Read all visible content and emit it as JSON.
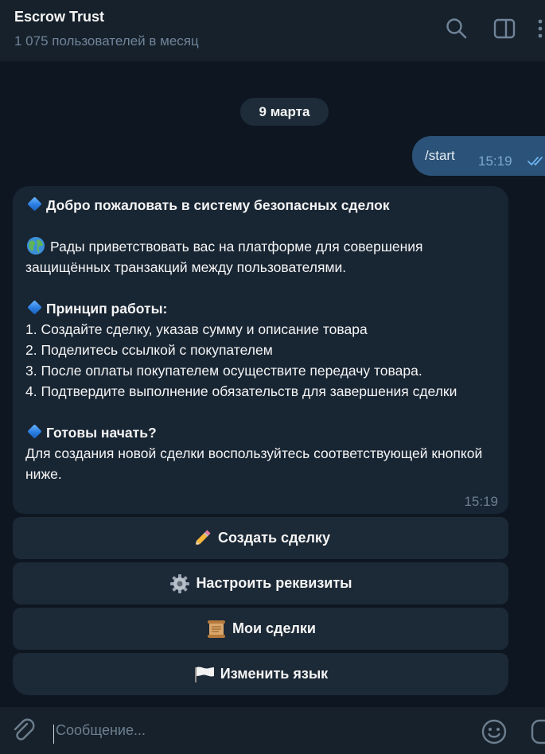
{
  "header": {
    "title": "Escrow Trust",
    "subtitle": "1 075 пользователей в месяц"
  },
  "date_divider": "9 марта",
  "outgoing_message": {
    "text": "/start",
    "time": "15:19"
  },
  "bot_message": {
    "title": "Добро пожаловать в систему безопасных сделок",
    "greeting": "Рады приветствовать вас на платформе для совершения защищённых транзакций между пользователями.",
    "section_how": "Принцип работы:",
    "steps": [
      "1. Создайте сделку, указав сумму и описание товара",
      "2. Поделитесь ссылкой с покупателем",
      "3. После оплаты покупателем осуществите передачу товара.",
      "4. Подтвердите выполнение обязательств для завершения сделки"
    ],
    "section_ready": "Готовы начать?",
    "cta": "Для создания новой сделки воспользуйтесь соответствующей кнопкой ниже.",
    "time": "15:19"
  },
  "keyboard": {
    "create": "Создать сделку",
    "setup": "Настроить реквизиты",
    "my_deals": "Мои сделки",
    "language": "Изменить язык"
  },
  "composer": {
    "placeholder": "Сообщение..."
  },
  "colors": {
    "background": "#0e1621",
    "header": "#17212b",
    "outgoing_bubble": "#2b5278",
    "incoming_bubble": "#182533",
    "button": "#1c2936",
    "accent": "#5eb5f7"
  }
}
